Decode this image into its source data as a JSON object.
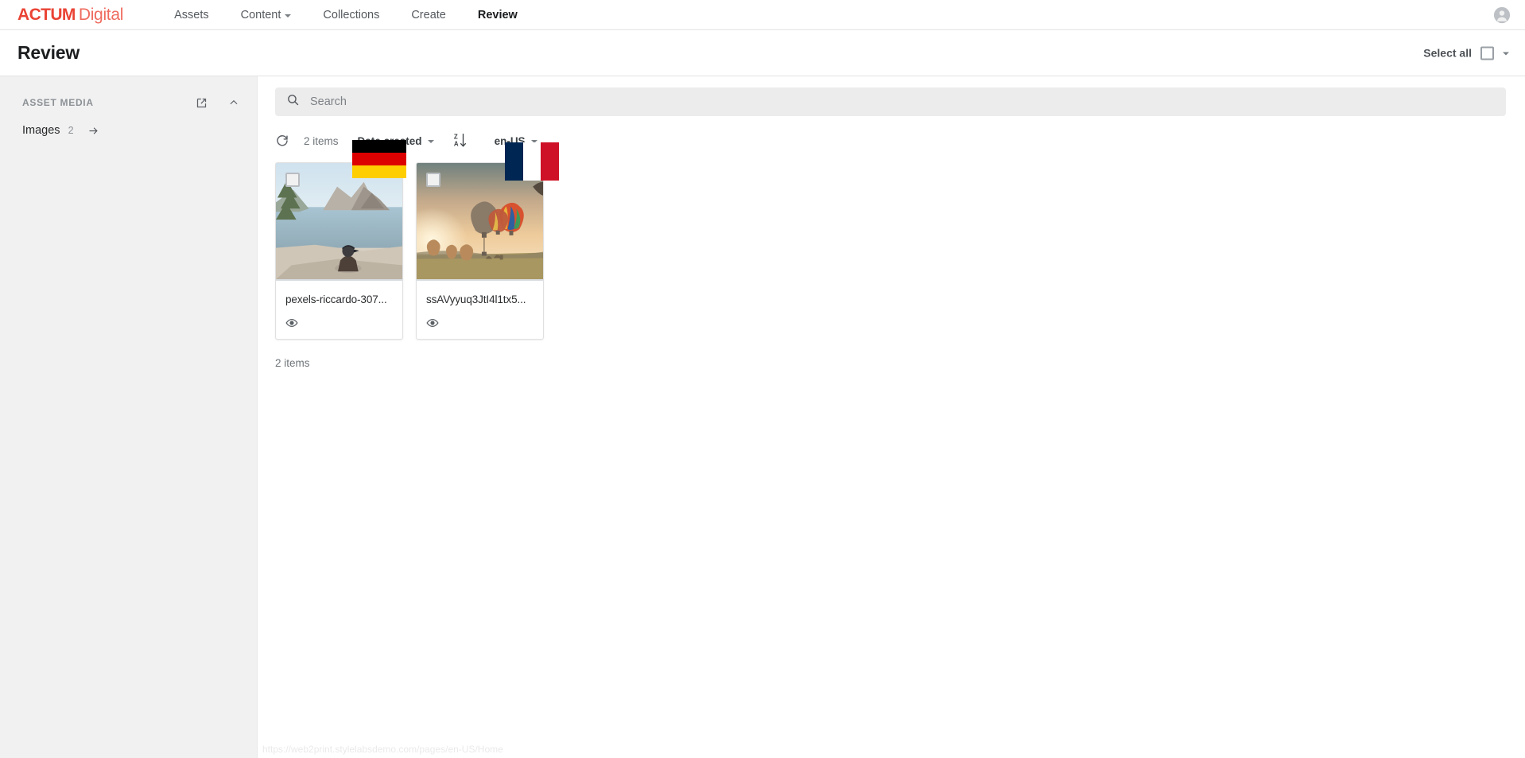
{
  "brand": {
    "mark": "ACTUM",
    "word": "Digital",
    "mark_color": "#ea4335",
    "word_color": "#ef6b5e"
  },
  "topnav": {
    "items": [
      {
        "label": "Assets",
        "has_caret": false,
        "active": false
      },
      {
        "label": "Content",
        "has_caret": true,
        "active": false
      },
      {
        "label": "Collections",
        "has_caret": false,
        "active": false
      },
      {
        "label": "Create",
        "has_caret": false,
        "active": false
      },
      {
        "label": "Review",
        "has_caret": false,
        "active": true
      }
    ],
    "account_icon": "user-avatar-icon"
  },
  "pagehead": {
    "title": "Review",
    "select_all_label": "Select all",
    "checkbox_checked": false,
    "dropdown_icon": "chevron-down-icon"
  },
  "sidebar": {
    "section_title": "ASSET MEDIA",
    "open_icon": "external-link-icon",
    "collapse_icon": "chevron-up-icon",
    "items": [
      {
        "label": "Images",
        "count": "2",
        "arrow_icon": "arrow-right-icon"
      }
    ]
  },
  "search": {
    "placeholder": "Search",
    "value": "",
    "icon": "search-icon"
  },
  "toolbar": {
    "refresh_icon": "refresh-icon",
    "item_count": "2 items",
    "sort_field": "Date created",
    "sort_direction_icon": "sort-z-to-a-descending-icon",
    "locale": "en-US"
  },
  "assets": {
    "cards": [
      {
        "name": "pexels-riccardo-307...",
        "checkbox_checked": false,
        "preview_icon": "eye-icon",
        "flag": {
          "country": "Germany",
          "code": "DE",
          "colors": [
            "#000000",
            "#DD0000",
            "#FFCE00"
          ]
        }
      },
      {
        "name": "ssAVyyuq3JtI4l1tx5...",
        "checkbox_checked": false,
        "preview_icon": "eye-icon",
        "flag": {
          "country": "France",
          "code": "FR",
          "colors": [
            "#002654",
            "#FFFFFF",
            "#CE1126"
          ]
        }
      }
    ],
    "footer_count": "2 items"
  },
  "statusbar": {
    "url": "https://web2print.stylelabsdemo.com/pages/en-US/Home"
  }
}
